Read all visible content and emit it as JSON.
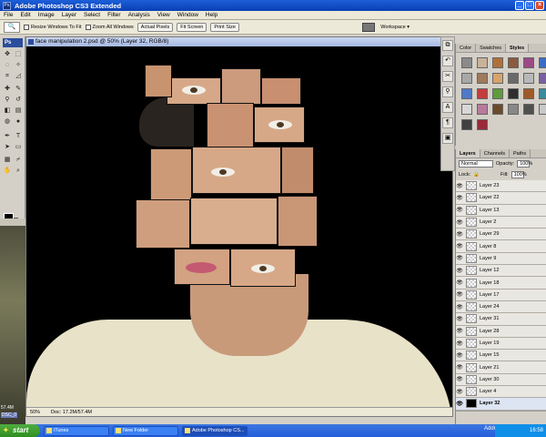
{
  "window": {
    "title": "Adobe Photoshop CS3 Extended",
    "app_badge": "Ps"
  },
  "menu": {
    "items": [
      "File",
      "Edit",
      "Image",
      "Layer",
      "Select",
      "Filter",
      "Analysis",
      "View",
      "Window",
      "Help"
    ]
  },
  "options": {
    "tool_icon": "🔍",
    "resize_windows_label": "Resize Windows To Fit",
    "zoom_all_label": "Zoom All Windows",
    "actual_pixels_label": "Actual Pixels",
    "fit_screen_label": "Fit Screen",
    "print_size_label": "Print Size",
    "workspace_label": "Workspace ▾"
  },
  "document": {
    "title": "face manipulation 2.psd @ 50% (Layer 32, RGB/8)",
    "zoom": "50%",
    "doc_size": "Doc: 17.2M/57.4M"
  },
  "swatches_panel": {
    "tabs": [
      "Color",
      "Swatches",
      "Styles"
    ],
    "active_tab": "Styles",
    "colors": [
      "#8a8a8a",
      "#c9b29a",
      "#b0703a",
      "#8c5a3e",
      "#9b4a86",
      "#3b6cc4",
      "#a8a8a8",
      "#a07a5c",
      "#d6a46a",
      "#6a6a6a",
      "#b8b8b8",
      "#7b5ea4",
      "#4f7ac8",
      "#c43c3c",
      "#5e9c3c",
      "#2f2f2f",
      "#a05a2a",
      "#3b8c9c",
      "#d8d8d8",
      "#b87a9c",
      "#6c4a2a",
      "#888888",
      "#505050",
      "#c8c8c8",
      "#404040",
      "#9a2a3a"
    ]
  },
  "layers_panel": {
    "tabs": [
      "Layers",
      "Channels",
      "Paths"
    ],
    "active_tab": "Layers",
    "blend_mode": "Normal",
    "opacity_label": "Opacity:",
    "opacity_value": "100%",
    "lock_label": "Lock:",
    "fill_label": "Fill:",
    "fill_value": "100%",
    "layers": [
      "Layer 23",
      "Layer 22",
      "Layer 13",
      "Layer 2",
      "Layer 29",
      "Layer 8",
      "Layer 9",
      "Layer 12",
      "Layer 18",
      "Layer 17",
      "Layer 24",
      "Layer 31",
      "Layer 28",
      "Layer 19",
      "Layer 15",
      "Layer 21",
      "Layer 30",
      "Layer 4",
      "Layer 32"
    ],
    "active_layer": "Layer 32"
  },
  "desktop_strip": {
    "note_top": "57.4M",
    "note_bottom": "DSC_0"
  },
  "taskbar": {
    "start_label": "start",
    "items": [
      "iTunes",
      "New Folder",
      "Adobe Photoshop CS..."
    ],
    "address_label": "Address",
    "clock": "16:58"
  }
}
